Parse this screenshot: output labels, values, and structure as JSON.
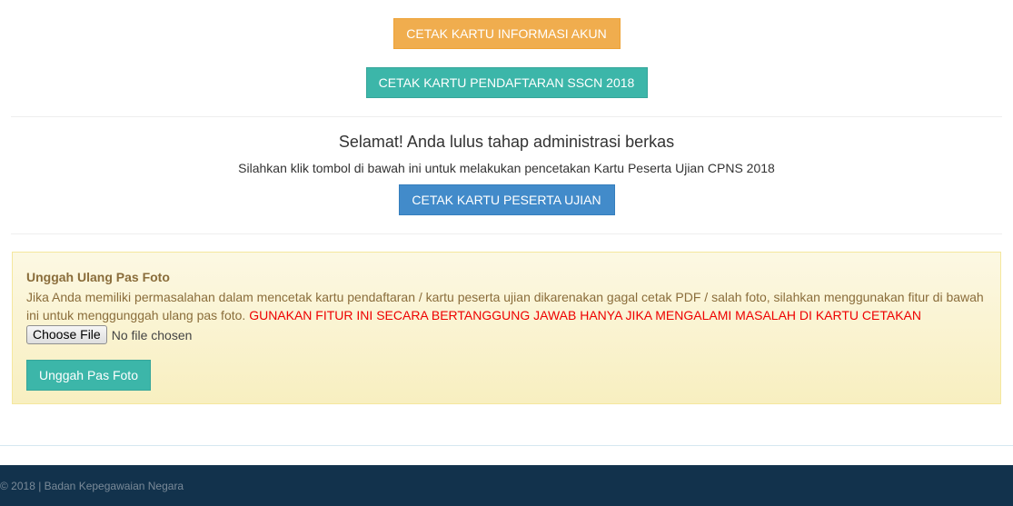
{
  "top_actions": {
    "account_card_label": "CETAK KARTU INFORMASI AKUN",
    "registration_card_label": "CETAK KARTU PENDAFTARAN SSCN 2018",
    "account_card_color": "#f0ad4e",
    "registration_card_color": "#3cb6a9"
  },
  "congrats": {
    "title": "Selamat! Anda lulus tahap administrasi berkas",
    "subtitle": "Silahkan klik tombol di bawah ini untuk melakukan pencetakan Kartu Peserta Ujian CPNS 2018",
    "exam_card_label": "CETAK KARTU PESERTA UJIAN",
    "exam_card_color": "#428bca"
  },
  "reupload": {
    "title": "Unggah Ulang Pas Foto",
    "description": "Jika Anda memiliki permasalahan dalam mencetak kartu pendaftaran / kartu peserta ujian dikarenakan gagal cetak PDF / salah foto, silahkan menggunakan fitur di bawah ini untuk menggunggah ulang pas foto.",
    "warning": "GUNAKAN FITUR INI SECARA BERTANGGUNG JAWAB HANYA JIKA MENGALAMI MASALAH DI KARTU CETAKAN",
    "warning_color": "#ee0000",
    "file_button_label": "Choose File",
    "file_status": "No file chosen",
    "upload_button_label": "Unggah Pas Foto"
  },
  "footer": {
    "text": "© 2018 | Badan Kepegawaian Negara",
    "background": "#12324c"
  }
}
